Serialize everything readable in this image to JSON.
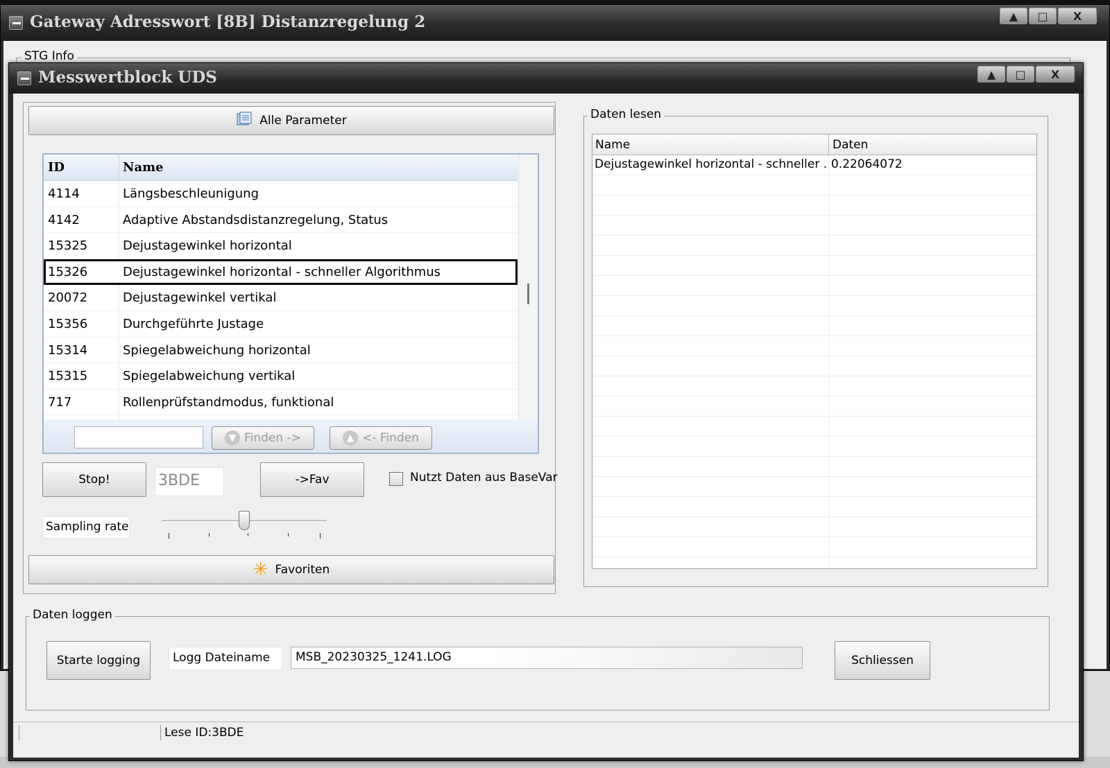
{
  "outer_window": {
    "title": "Gateway Adresswort [8B] Distanzregelung 2",
    "group_label": "STG Info",
    "buttons": {
      "minimize": "▲",
      "maximize": "□",
      "close": "X"
    }
  },
  "inner_window": {
    "title": "Messwertblock UDS",
    "buttons": {
      "minimize": "▲",
      "maximize": "□",
      "close": "X"
    }
  },
  "params": {
    "all_params_label": "Alle Parameter",
    "columns": {
      "id": "ID",
      "name": "Name"
    },
    "rows": [
      {
        "id": "4114",
        "name": "Längsbeschleunigung"
      },
      {
        "id": "4142",
        "name": "Adaptive Abstandsdistanzregelung, Status"
      },
      {
        "id": "15325",
        "name": "Dejustagewinkel horizontal"
      },
      {
        "id": "15326",
        "name": "Dejustagewinkel horizontal - schneller Algorithmus"
      },
      {
        "id": "20072",
        "name": "Dejustagewinkel vertikal"
      },
      {
        "id": "15356",
        "name": "Durchgeführte Justage"
      },
      {
        "id": "15314",
        "name": "Spiegelabweichung horizontal"
      },
      {
        "id": "15315",
        "name": "Spiegelabweichung vertikal"
      },
      {
        "id": "717",
        "name": "Rollenprüfstandmodus, funktional"
      }
    ],
    "selected_index": 3,
    "search_value": "",
    "find_next_label": "Finden ->",
    "find_prev_label": "<- Finden"
  },
  "controls": {
    "stop_label": "Stop!",
    "current_id": "3BDE",
    "fav_label": "->Fav",
    "basevar_label": "Nutzt Daten aus BaseVar",
    "basevar_checked": false,
    "sampling_label": "Sampling rate",
    "sampling_level": 0.5,
    "favorites_label": "Favoriten"
  },
  "read_data": {
    "group_label": "Daten lesen",
    "columns": {
      "name": "Name",
      "data": "Daten"
    },
    "rows": [
      {
        "name": "Dejustagewinkel horizontal - schneller ...",
        "data": "0.22064072"
      }
    ],
    "empty_rows": 20
  },
  "logging": {
    "group_label": "Daten loggen",
    "start_label": "Starte logging",
    "filename_label": "Logg Dateiname",
    "filename_value": "MSB_20230325_1241.LOG",
    "close_label": "Schliessen"
  },
  "status": {
    "text": "Lese ID:3BDE"
  },
  "colors": {
    "selection_border": "#000000",
    "list_border": "#9fb4cf",
    "titlebar": "#2b2b2b"
  }
}
